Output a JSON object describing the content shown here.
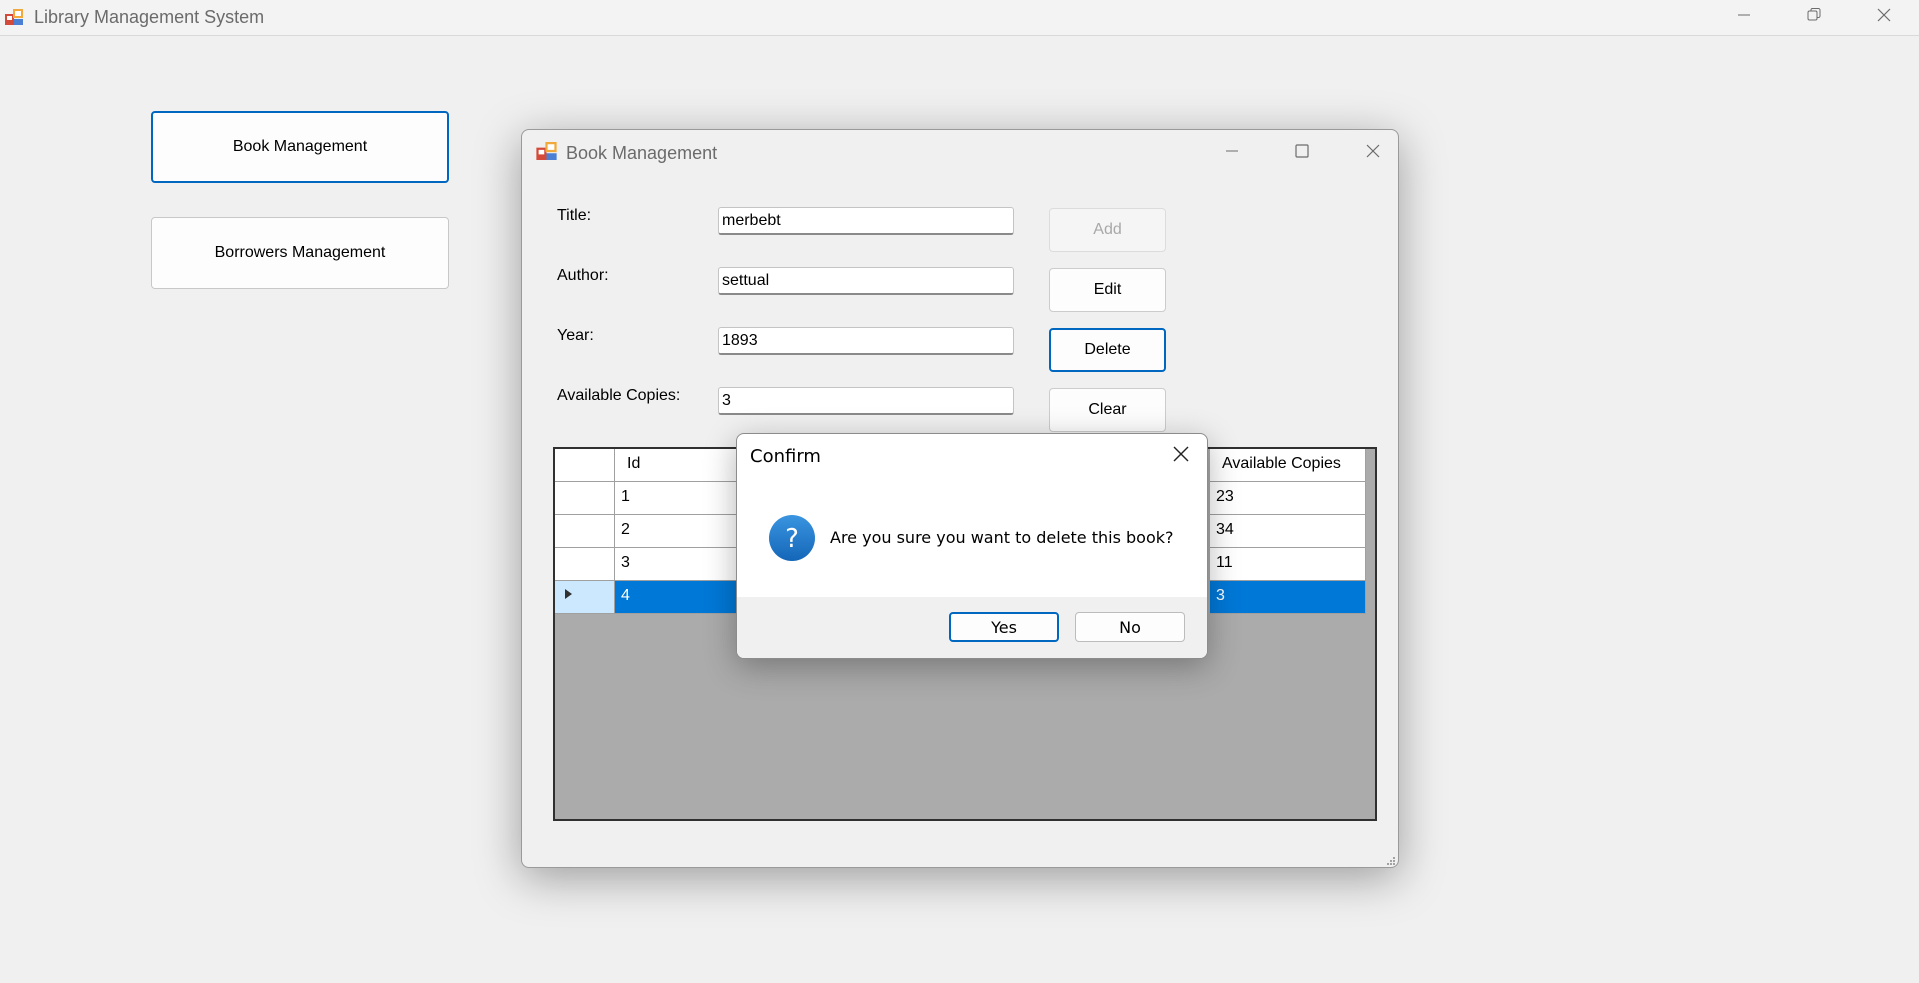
{
  "main_window": {
    "title": "Library Management System",
    "sidebar": {
      "book_management": "Book Management",
      "borrowers_management": "Borrowers Management"
    }
  },
  "child_window": {
    "title": "Book Management",
    "form": {
      "title_label": "Title:",
      "title_value": "merbebt",
      "author_label": "Author:",
      "author_value": "settual",
      "year_label": "Year:",
      "year_value": "1893",
      "copies_label": "Available Copies:",
      "copies_value": "3"
    },
    "buttons": {
      "add": "Add",
      "edit": "Edit",
      "delete": "Delete",
      "clear": "Clear"
    },
    "grid": {
      "columns": [
        "Id",
        "Available Copies"
      ],
      "rows": [
        {
          "id": "1",
          "copies": "23"
        },
        {
          "id": "2",
          "copies": "34"
        },
        {
          "id": "3",
          "copies": "11"
        },
        {
          "id": "4",
          "copies": "3"
        }
      ],
      "selected_row_index": 3
    }
  },
  "dialog": {
    "title": "Confirm",
    "message": "Are you sure you want to delete this book?",
    "yes": "Yes",
    "no": "No"
  },
  "colors": {
    "accent": "#0067c0",
    "selection": "#0078d7",
    "question_icon": "#1f7fcf"
  }
}
